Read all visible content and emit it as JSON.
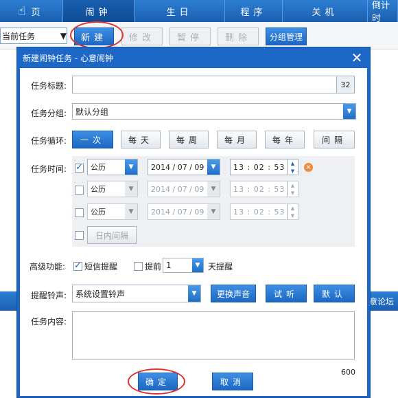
{
  "topbar": {
    "tabs": [
      {
        "label": "页"
      },
      {
        "label": "闹钟"
      },
      {
        "label": "生日"
      },
      {
        "label": "程序"
      },
      {
        "label": "关机"
      },
      {
        "label": "倒计时"
      }
    ]
  },
  "toolbar": {
    "task_filter": "当前任务",
    "new_label": "新建",
    "edit_label": "修改",
    "pause_label": "暂停",
    "delete_label": "删除",
    "group_label": "分组管理"
  },
  "background": {
    "forum_text": "意论坛"
  },
  "dialog": {
    "title": "新建闹钟任务 - 心意闹钟",
    "task_title_label": "任务标题:",
    "task_title_value": "",
    "task_title_counter": "32",
    "group_label": "任务分组:",
    "group_value": "默认分组",
    "cycle_label": "任务循环:",
    "cycle_buttons": [
      "一次",
      "每天",
      "每周",
      "每月",
      "每年",
      "间隔"
    ],
    "time_label": "任务时间:",
    "time_rows": [
      {
        "calendar": "公历",
        "date": "2014 / 07 / 09",
        "time": "13 : 02 : 53",
        "checked": true,
        "enabled": true
      },
      {
        "calendar": "公历",
        "date": "2014 / 07 / 09",
        "time": "13 : 02 : 53",
        "checked": false,
        "enabled": false
      },
      {
        "calendar": "公历",
        "date": "2014 / 07 / 09",
        "time": "13 : 02 : 53",
        "checked": false,
        "enabled": false
      }
    ],
    "intraday_label": "日内间隔",
    "advanced_label": "高级功能:",
    "sms_label": "短信提醒",
    "advance_label": "提前",
    "advance_value": "1",
    "days_label": "天提醒",
    "ringtone_label": "提醒铃声:",
    "ringtone_value": "系统设置铃声",
    "change_sound_label": "更换声音",
    "listen_label": "试听",
    "default_label": "默认",
    "content_label": "任务内容:",
    "content_value": "",
    "content_counter": "600",
    "ok_label": "确定",
    "cancel_label": "取消"
  },
  "colors": {
    "accent": "#1d67c2",
    "annotation": "#e03030"
  }
}
